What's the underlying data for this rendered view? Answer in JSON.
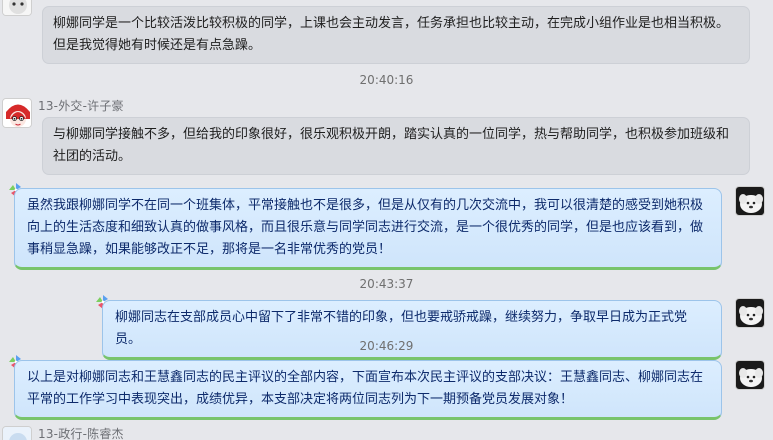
{
  "messages": [
    {
      "type": "incoming",
      "text": "柳娜同学是一个比较活泼比较积极的同学，上课也会主动发言，任务承担也比较主动，在完成小组作业是也相当积极。但是我觉得她有时候还是有点急躁。"
    },
    {
      "type": "timestamp",
      "text": "20:40:16"
    },
    {
      "type": "incoming",
      "sender": "13-外交-许子豪",
      "text": "与柳娜同学接触不多，但给我的印象很好，很乐观积极开朗，踏实认真的一位同学，热与帮助同学，也积极参加班级和社团的活动。"
    },
    {
      "type": "outgoing",
      "text": "虽然我跟柳娜同学不在同一个班集体，平常接触也不是很多，但是从仅有的几次交流中，我可以很清楚的感受到她积极向上的生活态度和细致认真的做事风格，而且很乐意与同学同志进行交流，是一个很优秀的同学，但是也应该看到，做事稍显急躁，如果能够改正不足，那将是一名非常优秀的党员！"
    },
    {
      "type": "timestamp",
      "text": "20:43:37"
    },
    {
      "type": "outgoing",
      "text": "柳娜同志在支部成员心中留下了非常不错的印象，但也要戒骄戒躁，继续努力，争取早日成为正式党员。"
    },
    {
      "type": "timestamp",
      "text": "20:46:29"
    },
    {
      "type": "outgoing",
      "text": "以上是对柳娜同志和王慧鑫同志的民主评议的全部内容，下面宣布本次民主评议的支部决议：王慧鑫同志、柳娜同志在平常的工作学习中表现突出，成绩优异，本支部决定将两位同志列为下一期预备党员发展对象！"
    },
    {
      "type": "incoming",
      "sender": "13-政行-陈睿杰"
    }
  ],
  "icons": {
    "incoming_avatar_1": "red-cartoon-avatar",
    "outgoing_avatar": "white-dog-avatar",
    "bubble_decoration": "pinwheel-icon"
  },
  "colors": {
    "outgoing_bubble": "#d4e8fc",
    "incoming_bubble": "#d9dbe0",
    "outgoing_text": "#0d2a6b"
  }
}
